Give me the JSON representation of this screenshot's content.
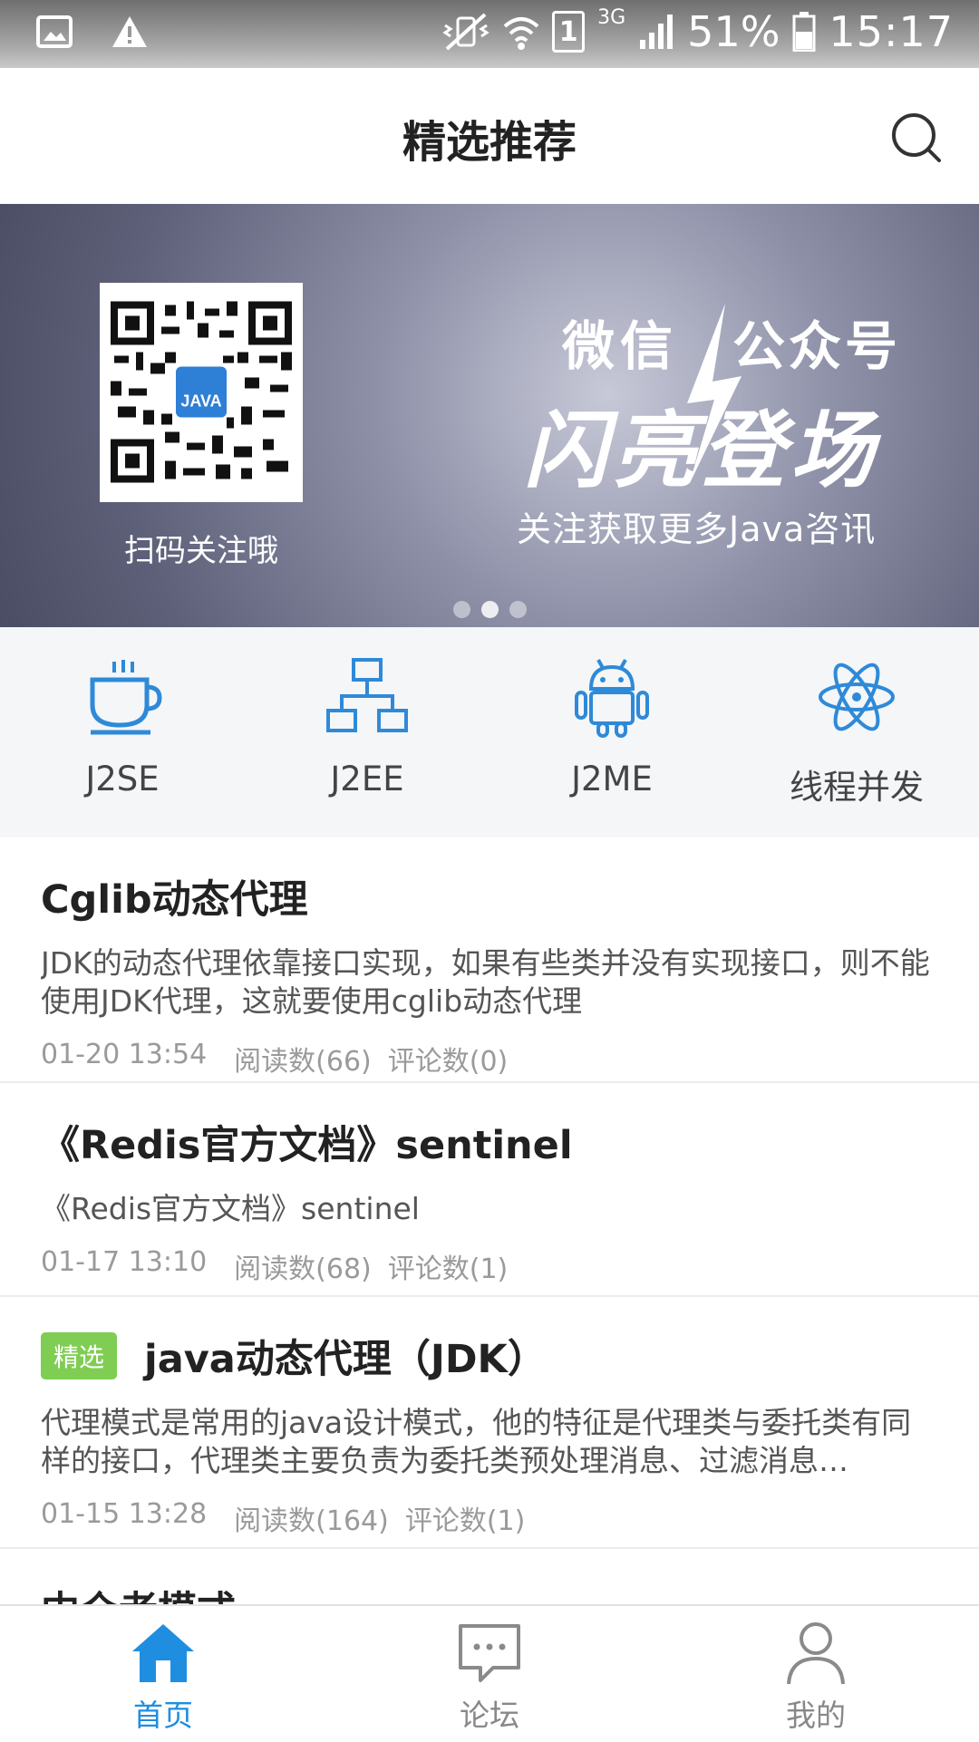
{
  "status_bar": {
    "battery": "51%",
    "time": "15:17",
    "network": "3G",
    "sim": "1"
  },
  "header": {
    "title": "精选推荐"
  },
  "banner": {
    "qr_caption": "扫码关注哦",
    "qr_badge": "JAVA",
    "title_left": "微信",
    "title_right": "公众号",
    "title_big": "闪亮登场",
    "subtitle": "关注获取更多Java咨讯"
  },
  "categories": [
    {
      "label": "J2SE",
      "icon": "coffee-cup-icon"
    },
    {
      "label": "J2EE",
      "icon": "hierarchy-icon"
    },
    {
      "label": "J2ME",
      "icon": "android-icon"
    },
    {
      "label": "线程并发",
      "icon": "atom-icon"
    }
  ],
  "articles": [
    {
      "title": "Cglib动态代理",
      "summary": "JDK的动态代理依靠接口实现，如果有些类并没有实现接口，则不能使用JDK代理，这就要使用cglib动态代理",
      "date": "01-20 13:54",
      "reads": "阅读数(66)",
      "comments": "评论数(0)"
    },
    {
      "title": "《Redis官方文档》sentinel",
      "summary": "《Redis官方文档》sentinel",
      "date": "01-17 13:10",
      "reads": "阅读数(68)",
      "comments": "评论数(1)"
    },
    {
      "badge": "精选",
      "title": "java动态代理（JDK）",
      "summary": "代理模式是常用的java设计模式，他的特征是代理类与委托类有同样的接口，代理类主要负责为委托类预处理消息、过滤消息…",
      "date": "01-15 13:28",
      "reads": "阅读数(164)",
      "comments": "评论数(1)"
    },
    {
      "title": "中介者模式"
    }
  ],
  "bottom_nav": [
    {
      "label": "首页",
      "icon": "home-icon",
      "active": true
    },
    {
      "label": "论坛",
      "icon": "chat-icon",
      "active": false
    },
    {
      "label": "我的",
      "icon": "user-icon",
      "active": false
    }
  ],
  "colors": {
    "accent": "#1f8ee0",
    "icon_blue": "#2e8ad8",
    "badge_green": "#7fcd52"
  }
}
